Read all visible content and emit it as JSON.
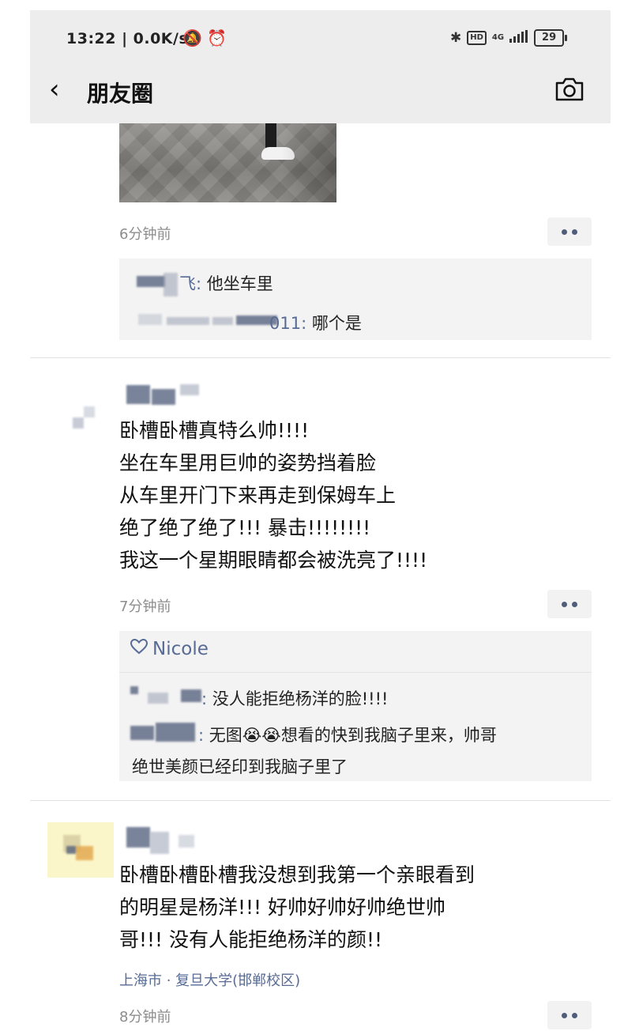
{
  "status_bar": {
    "time": "13:22 | 0.0K/s",
    "network_label": "4G",
    "hd_label": "HD",
    "battery": "29"
  },
  "nav": {
    "title": "朋友圈"
  },
  "post1": {
    "time": "6分钟前",
    "comments": [
      {
        "author_suffix": "飞:",
        "text": "他坐车里"
      },
      {
        "author_suffix": "011:",
        "text": "哪个是"
      }
    ]
  },
  "post2": {
    "lines": [
      "卧槽卧槽真特么帅!!!!",
      "坐在车里用巨帅的姿势挡着脸",
      "从车里开门下来再走到保姆车上",
      "绝了绝了绝了!!! 暴击!!!!!!!!",
      "我这一个星期眼睛都会被洗亮了!!!!"
    ],
    "time": "7分钟前",
    "likes": "Nicole",
    "comments": [
      {
        "author_suffix": ":",
        "text": "没人能拒绝杨洋的脸!!!!"
      },
      {
        "author_suffix": ":",
        "text": "无图",
        "emoji": "😭😭",
        "text_after": "想看的快到我脑子里来，帅哥",
        "line2": "绝世美颜已经印到我脑子里了"
      }
    ]
  },
  "post3": {
    "lines": [
      "卧槽卧槽卧槽我没想到我第一个亲眼看到",
      "的明星是杨洋!!! 好帅好帅好帅绝世帅",
      "哥!!! 没有人能拒绝杨洋的颜!!"
    ],
    "location": "上海市 · 复旦大学(邯郸校区)",
    "time": "8分钟前"
  },
  "colors": {
    "link_blue": "#576b95",
    "meta_gray": "#8c8c8c",
    "header_bg": "#ededed"
  }
}
